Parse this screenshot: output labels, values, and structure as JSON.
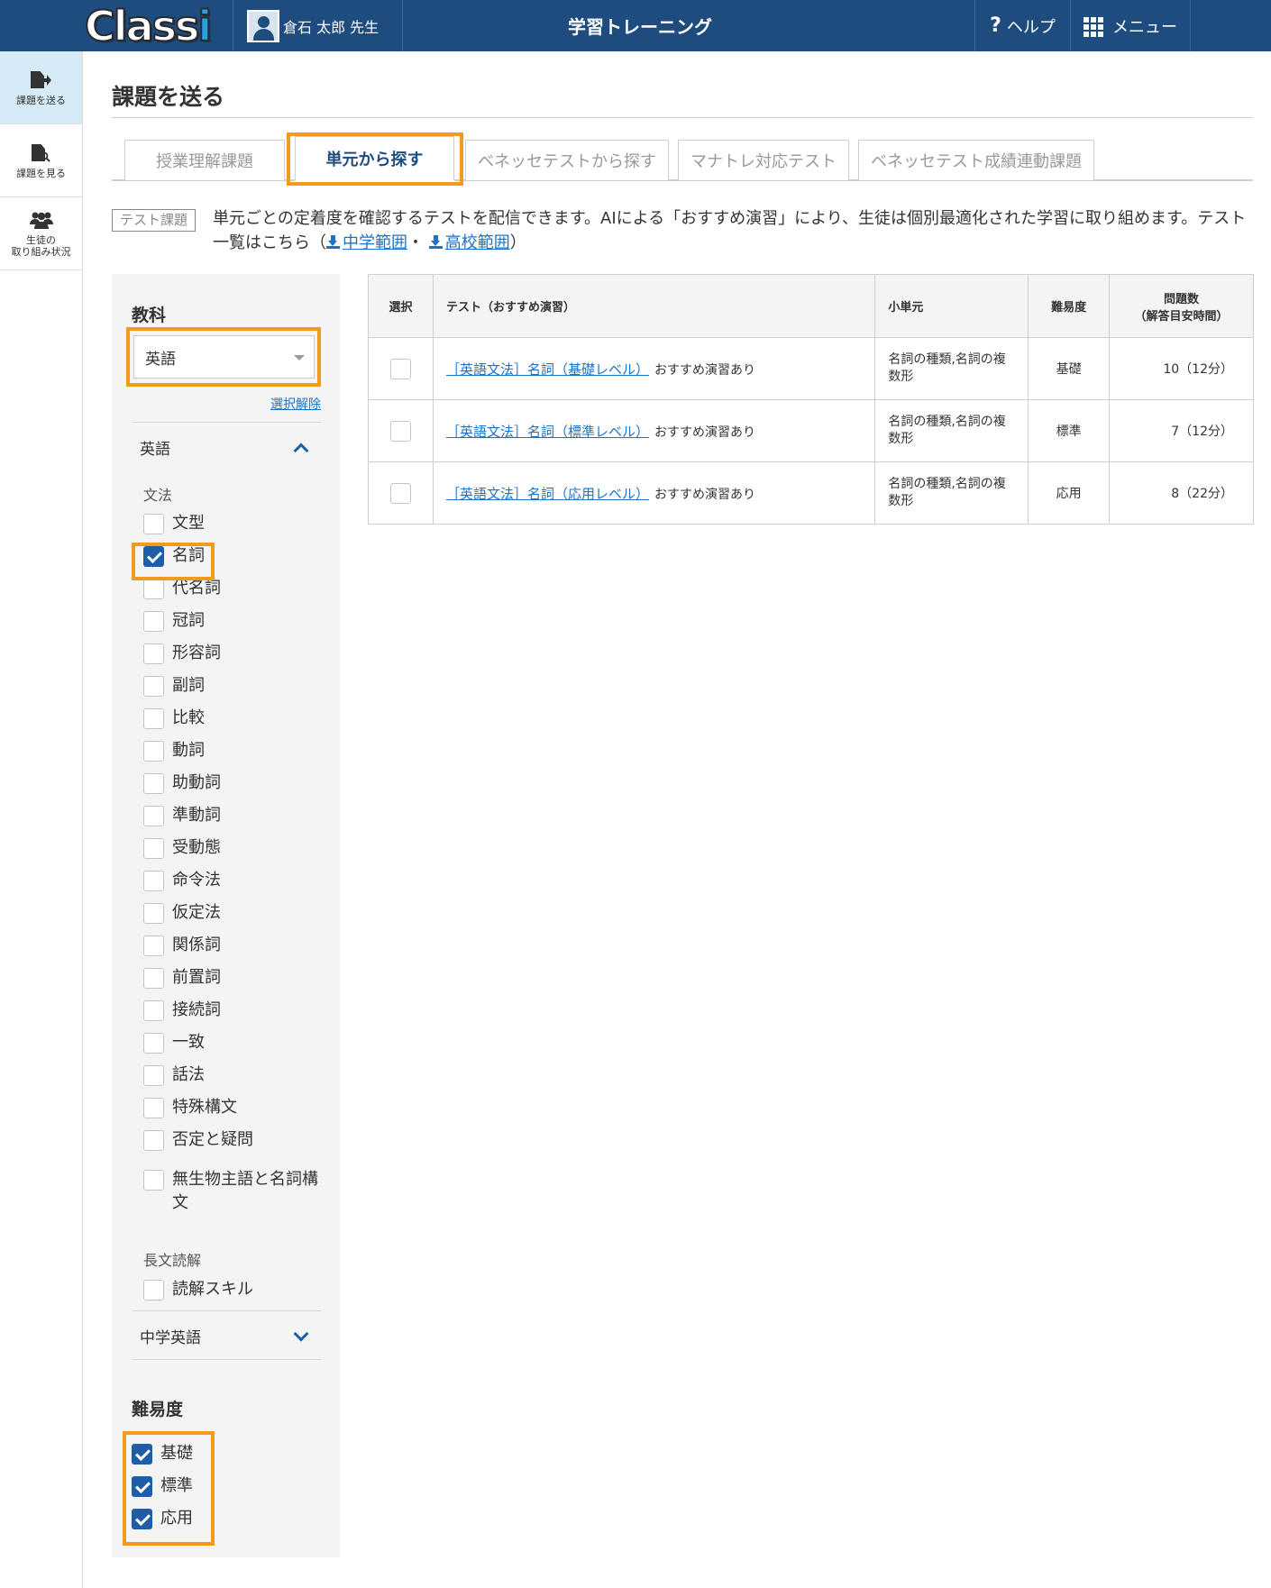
{
  "header": {
    "logo": "Classi",
    "user_name": "倉石 太郎 先生",
    "app_title": "学習トレーニング",
    "help_label": "ヘルプ",
    "menu_label": "メニュー"
  },
  "leftnav": {
    "items": [
      {
        "label": "課題を送る",
        "icon": "send-document-icon",
        "active": true
      },
      {
        "label": "課題を見る",
        "icon": "search-document-icon",
        "active": false
      },
      {
        "label_line1": "生徒の",
        "label_line2": "取り組み状況",
        "icon": "people-icon",
        "active": false
      }
    ]
  },
  "page": {
    "title": "課題を送る",
    "tabs": [
      {
        "label": "授業理解課題",
        "active": false
      },
      {
        "label": "単元から探す",
        "active": true
      },
      {
        "label": "ベネッセテストから探す",
        "active": false
      },
      {
        "label": "マナトレ対応テスト",
        "active": false
      },
      {
        "label": "ベネッセテスト成績連動課題",
        "active": false
      }
    ],
    "tag": "テスト課題",
    "description_line1": "単元ごとの定着度を確認するテストを配信できます。AIによる「おすすめ演習」により、生徒は個別最適化された学習に取り組めます。テスト",
    "description_line2_prefix": "一覧はこちら（",
    "link_junior": "中学範囲",
    "separator": "・",
    "link_high": "高校範囲",
    "description_line2_suffix": "）"
  },
  "filter": {
    "subject_heading": "教科",
    "subject_value": "英語",
    "clear_label": "選択解除",
    "accordion_open": "英語",
    "group_grammar": "文法",
    "grammar_items": [
      {
        "label": "文型",
        "checked": false
      },
      {
        "label": "名詞",
        "checked": true
      },
      {
        "label": "代名詞",
        "checked": false
      },
      {
        "label": "冠詞",
        "checked": false
      },
      {
        "label": "形容詞",
        "checked": false
      },
      {
        "label": "副詞",
        "checked": false
      },
      {
        "label": "比較",
        "checked": false
      },
      {
        "label": "動詞",
        "checked": false
      },
      {
        "label": "助動詞",
        "checked": false
      },
      {
        "label": "準動詞",
        "checked": false
      },
      {
        "label": "受動態",
        "checked": false
      },
      {
        "label": "命令法",
        "checked": false
      },
      {
        "label": "仮定法",
        "checked": false
      },
      {
        "label": "関係詞",
        "checked": false
      },
      {
        "label": "前置詞",
        "checked": false
      },
      {
        "label": "接続詞",
        "checked": false
      },
      {
        "label": "一致",
        "checked": false
      },
      {
        "label": "話法",
        "checked": false
      },
      {
        "label": "特殊構文",
        "checked": false
      },
      {
        "label": "否定と疑問",
        "checked": false
      }
    ],
    "grammar_last_line1": "無生物主語と名詞構",
    "grammar_last_line2": "文",
    "group_reading": "長文読解",
    "reading_item": "読解スキル",
    "accordion_closed": "中学英語",
    "difficulty_heading": "難易度",
    "difficulty_items": [
      {
        "label": "基礎",
        "checked": true
      },
      {
        "label": "標準",
        "checked": true
      },
      {
        "label": "応用",
        "checked": true
      }
    ]
  },
  "table": {
    "headers": {
      "select": "選択",
      "test": "テスト（おすすめ演習）",
      "unit": "小単元",
      "difficulty": "難易度",
      "count_line1": "問題数",
      "count_line2": "（解答目安時間）"
    },
    "rows": [
      {
        "test": "［英語文法］名詞（基礎レベル）",
        "rec": "おすすめ演習あり",
        "unit": "名詞の種類,名詞の複数形",
        "difficulty": "基礎",
        "count": "10（12分）"
      },
      {
        "test": "［英語文法］名詞（標準レベル）",
        "rec": "おすすめ演習あり",
        "unit": "名詞の種類,名詞の複数形",
        "difficulty": "標準",
        "count": "7（12分）"
      },
      {
        "test": "［英語文法］名詞（応用レベル）",
        "rec": "おすすめ演習あり",
        "unit": "名詞の種類,名詞の複数形",
        "difficulty": "応用",
        "count": "8（22分）"
      }
    ]
  },
  "colors": {
    "header_bg": "#1e4c7f",
    "highlight": "#f29a1b",
    "link": "#1a73c8",
    "checkbox_checked": "#1e5ea8",
    "nav_active": "#d6eaf7"
  }
}
